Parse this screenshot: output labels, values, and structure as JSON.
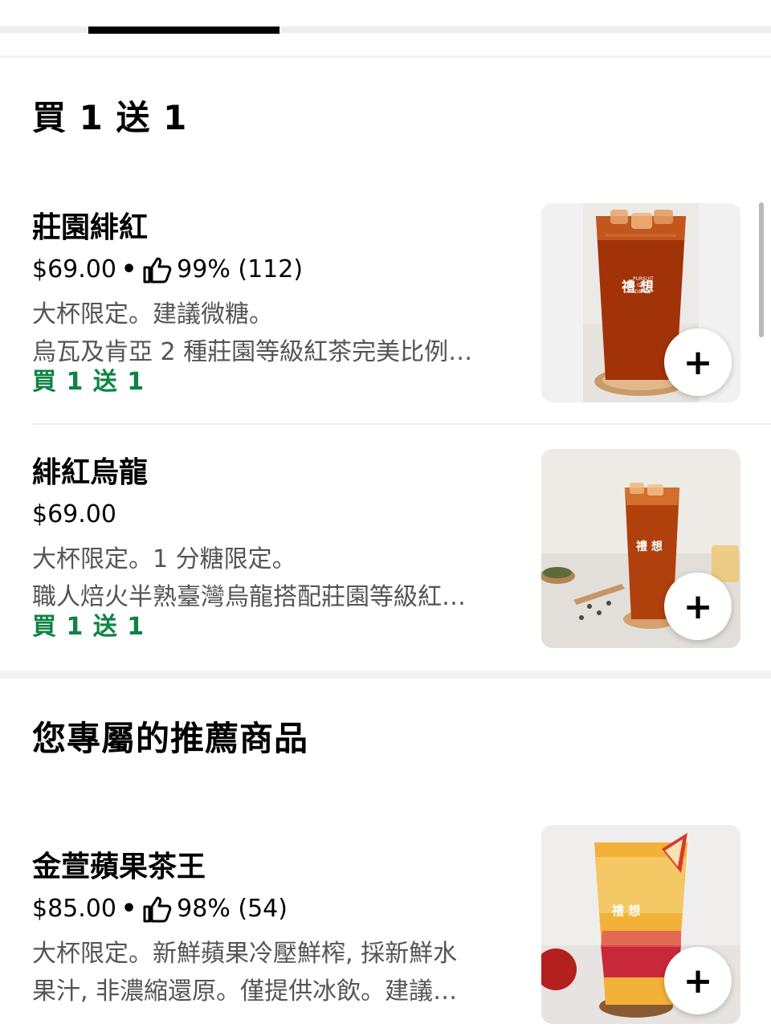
{
  "sections": [
    {
      "title": "買 1 送 1",
      "items": [
        {
          "name": "莊園緋紅",
          "price": "$69.00",
          "rating": "99% (112)",
          "desc_line1": "大杯限定。建議微糖。",
          "desc_line2": "烏瓦及肯亞 2 種莊園等級紅茶完美比例…",
          "promo": "買 1 送 1",
          "image_icon": "black-tea-cup-image",
          "add_label": "+"
        },
        {
          "name": "緋紅烏龍",
          "price": "$69.00",
          "desc_line1": "大杯限定。1 分糖限定。",
          "desc_line2": "職人焙火半熟臺灣烏龍搭配莊園等級紅…",
          "promo": "買 1 送 1",
          "image_icon": "oolong-tea-cup-image",
          "add_label": "+"
        }
      ]
    },
    {
      "title": "您專屬的推薦商品",
      "items": [
        {
          "name": "金萱蘋果茶王",
          "price": "$85.00",
          "rating": "98% (54)",
          "desc_line1": "大杯限定。新鮮蘋果冷壓鮮榨, 採新鮮水",
          "desc_line2": "果汁, 非濃縮還原。僅提供冰飲。建議…",
          "image_icon": "apple-tea-cup-image",
          "add_label": "+"
        }
      ]
    }
  ],
  "cup_logo": {
    "main": "禮 想",
    "sub1": "PURSUIT",
    "sub2": "OF",
    "sub3": "IDEALS"
  },
  "colors": {
    "promo_green": "#0e8345",
    "text_secondary": "#545454",
    "divider": "#eeeeee"
  }
}
